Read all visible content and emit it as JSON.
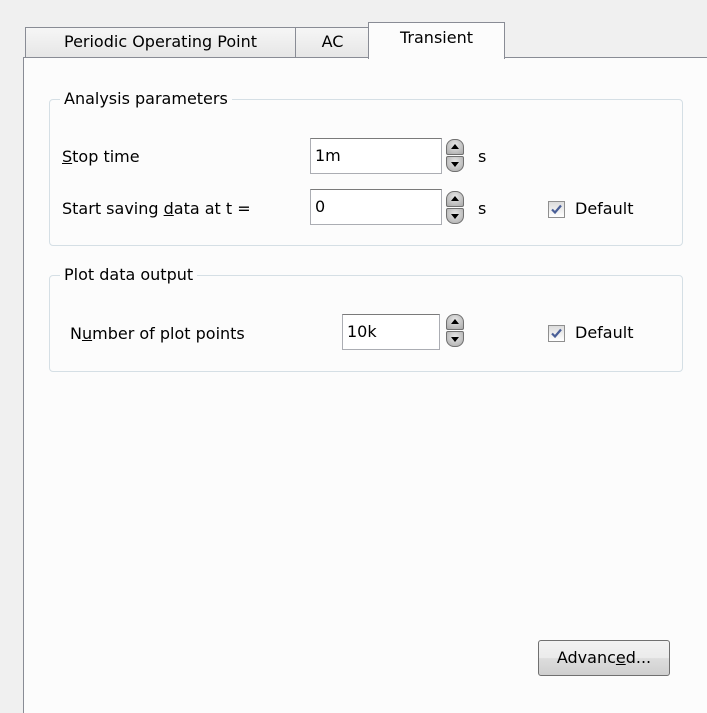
{
  "tabs": [
    {
      "label": "Periodic Operating Point",
      "active": false
    },
    {
      "label": "AC",
      "active": false
    },
    {
      "label": "Transient",
      "active": true
    }
  ],
  "analysis": {
    "title": "Analysis parameters",
    "stop_time": {
      "label_prefix": "",
      "label_mnemonic": "S",
      "label_suffix": "top time",
      "value": "1m",
      "unit": "s"
    },
    "start_saving": {
      "label_prefix": "Start saving ",
      "label_mnemonic": "d",
      "label_suffix": "ata at t =",
      "value": "0",
      "unit": "s",
      "default_label": "Default",
      "default_checked": true
    }
  },
  "plot": {
    "title": "Plot data output",
    "points": {
      "label_prefix": "N",
      "label_mnemonic": "u",
      "label_suffix": "mber of plot points",
      "value": "10k",
      "default_label": "Default",
      "default_checked": true
    }
  },
  "advanced_button": {
    "prefix": "Advanc",
    "mnemonic": "e",
    "suffix": "d..."
  },
  "icons": {
    "spinner": "spin-up-down-icon",
    "checkmark": "checkmark-icon"
  },
  "colors": {
    "window_bg": "#f0f0f0",
    "panel_bg": "#fcfcfc",
    "border": "#898c95",
    "group_border": "#d5dfe5",
    "check_color": "#4a5f97"
  }
}
